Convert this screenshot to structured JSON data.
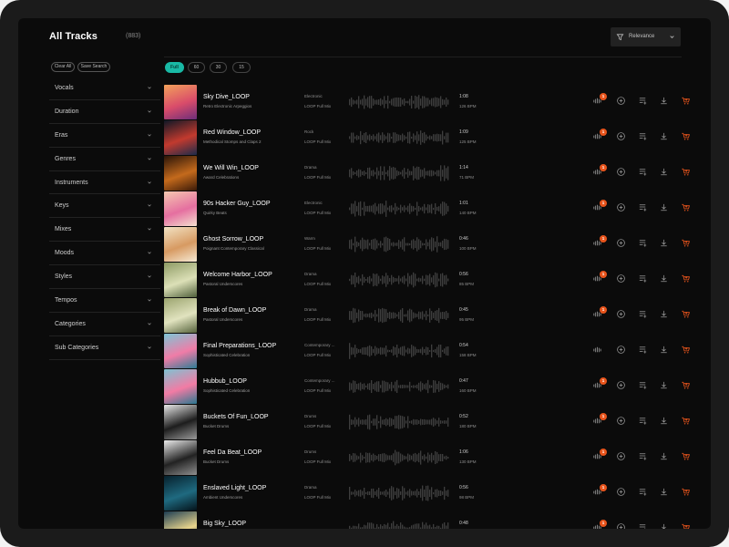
{
  "header": {
    "title": "All Tracks",
    "count": "(883)",
    "sort_label": "Relevance"
  },
  "sidebar": {
    "clear_all": "Clear All",
    "save_search": "Save Search",
    "filters": [
      "Vocals",
      "Duration",
      "Eras",
      "Genres",
      "Instruments",
      "Keys",
      "Mixes",
      "Moods",
      "Styles",
      "Tempos",
      "Categories",
      "Sub Categories"
    ]
  },
  "duration_tabs": [
    "Full",
    "60",
    "30",
    "15"
  ],
  "active_duration_tab": "Full",
  "colors": {
    "accent": "#19b9a5",
    "badge": "#e8541c"
  },
  "tracks": [
    {
      "name": "Sky Dive_LOOP",
      "album": "Retro Electronic Arpeggios",
      "genre": "Electronic",
      "mix": "LOOP Full Mix",
      "duration": "1:08",
      "bpm": "126 BPM",
      "badge": "1",
      "art": [
        "#f3a25a",
        "#d94c6a",
        "#6b2d7a"
      ]
    },
    {
      "name": "Red Window_LOOP",
      "album": "Methodical Stomps and Claps 2",
      "genre": "Rock",
      "mix": "LOOP Full Mix",
      "duration": "1:09",
      "bpm": "125 BPM",
      "badge": "1",
      "art": [
        "#0e1726",
        "#c23a2e",
        "#1c2b4a"
      ]
    },
    {
      "name": "We Will Win_LOOP",
      "album": "Award Celebrations",
      "genre": "Drama",
      "mix": "LOOP Full Mix",
      "duration": "1:14",
      "bpm": "71 BPM",
      "badge": "1",
      "art": [
        "#2a1408",
        "#c46a1c",
        "#3b1a08"
      ]
    },
    {
      "name": "90s Hacker Guy_LOOP",
      "album": "Quirky Beats",
      "genre": "Electronic",
      "mix": "LOOP Full Mix",
      "duration": "1:01",
      "bpm": "140 BPM",
      "badge": "1",
      "art": [
        "#f5c9b0",
        "#e56fa0",
        "#f3e0cf"
      ]
    },
    {
      "name": "Ghost Sorrow_LOOP",
      "album": "Poignant Contemporary Classical",
      "genre": "Warm",
      "mix": "LOOP Full Mix",
      "duration": "0:46",
      "bpm": "100 BPM",
      "badge": "1",
      "art": [
        "#f2e3c4",
        "#d79a62",
        "#f6ead4"
      ]
    },
    {
      "name": "Welcome Harbor_LOOP",
      "album": "Pastoral Underscores",
      "genre": "Drama",
      "mix": "LOOP Full Mix",
      "duration": "0:56",
      "bpm": "85 BPM",
      "badge": "1",
      "art": [
        "#8d9a63",
        "#dce0b7",
        "#4f5f3a"
      ]
    },
    {
      "name": "Break of Dawn_LOOP",
      "album": "Pastoral Underscores",
      "genre": "Drama",
      "mix": "LOOP Full Mix",
      "duration": "0:45",
      "bpm": "95 BPM",
      "badge": "1",
      "art": [
        "#9ba46e",
        "#e1e3bf",
        "#56633c"
      ]
    },
    {
      "name": "Final Preparations_LOOP",
      "album": "Sophisticated Celebration",
      "genre": "Contemporary ...",
      "mix": "LOOP Full Mix",
      "duration": "0:54",
      "bpm": "158 BPM",
      "badge": "",
      "art": [
        "#7dc6d6",
        "#f07ca7",
        "#2d7c95"
      ]
    },
    {
      "name": "Hubbub_LOOP",
      "album": "Sophisticated Celebration",
      "genre": "Contemporary ...",
      "mix": "LOOP Full Mix",
      "duration": "0:47",
      "bpm": "160 BPM",
      "badge": "1",
      "art": [
        "#7ec3d3",
        "#f27ba4",
        "#2a7890"
      ]
    },
    {
      "name": "Buckets Of Fun_LOOP",
      "album": "Bucket Drums",
      "genre": "Drums",
      "mix": "LOOP Full Mix",
      "duration": "0:52",
      "bpm": "180 BPM",
      "badge": "1",
      "art": [
        "#e9e9e9",
        "#1d1d1d",
        "#9a9a9a"
      ]
    },
    {
      "name": "Feel Da Beat_LOOP",
      "album": "Bucket Drums",
      "genre": "Drums",
      "mix": "LOOP Full Mix",
      "duration": "1:06",
      "bpm": "130 BPM",
      "badge": "1",
      "art": [
        "#ececec",
        "#222222",
        "#8f8f8f"
      ]
    },
    {
      "name": "Enslaved Light_LOOP",
      "album": "Ambient Underscores",
      "genre": "Drama",
      "mix": "LOOP Full Mix",
      "duration": "0:56",
      "bpm": "98 BPM",
      "badge": "1",
      "art": [
        "#06202c",
        "#1f6a80",
        "#041219"
      ]
    },
    {
      "name": "Big Sky_LOOP",
      "album": "",
      "genre": "",
      "mix": "LOOP Full Mix",
      "duration": "0:48",
      "bpm": "",
      "badge": "1",
      "art": [
        "#1c3d52",
        "#e8d48c",
        "#0c2030"
      ]
    }
  ]
}
